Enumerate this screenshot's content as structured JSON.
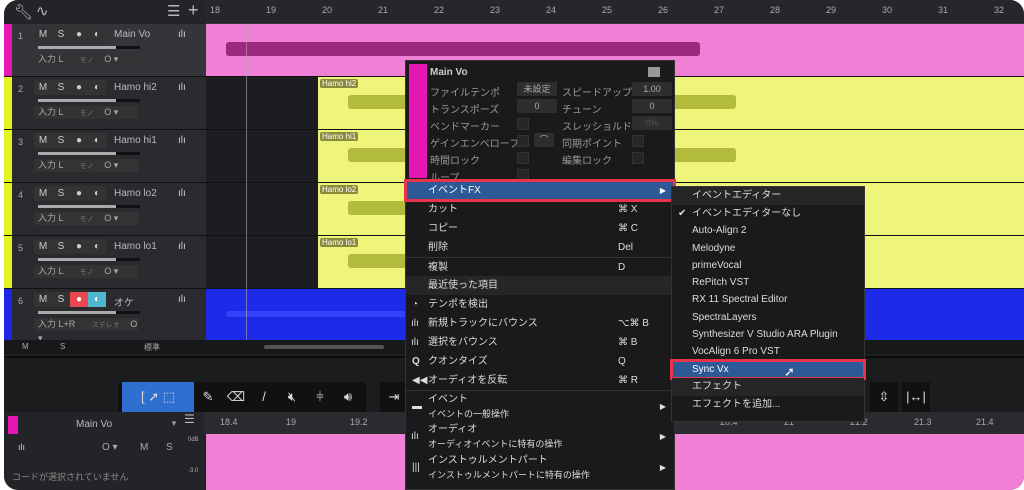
{
  "toolbar_top": {
    "wrench": "wrench-icon",
    "automation": "automation-icon"
  },
  "ruler": [
    "18",
    "19",
    "20",
    "21",
    "22",
    "23",
    "24",
    "25",
    "26",
    "27",
    "28",
    "29",
    "30",
    "31",
    "32"
  ],
  "tracks": [
    {
      "num": "1",
      "name": "Main Vo",
      "input": "入力 L",
      "mode": "モノ",
      "color": "#e617b4",
      "lane": "#f07fd6"
    },
    {
      "num": "2",
      "name": "Hamo hi2",
      "input": "入力 L",
      "mode": "モノ",
      "color": "#e3f320",
      "lane": "#eef57a",
      "clip": "Hamo hi2"
    },
    {
      "num": "3",
      "name": "Hamo hi1",
      "input": "入力 L",
      "mode": "モノ",
      "color": "#e3f320",
      "lane": "#eef57a",
      "clip": "Hamo hi1"
    },
    {
      "num": "4",
      "name": "Hamo lo2",
      "input": "入力 L",
      "mode": "モノ",
      "color": "#e3f320",
      "lane": "#eef57a",
      "clip": "Hamo lo2"
    },
    {
      "num": "5",
      "name": "Hamo lo1",
      "input": "入力 L",
      "mode": "モノ",
      "color": "#e3f320",
      "lane": "#eef57a",
      "clip": "Hamo lo1"
    },
    {
      "num": "6",
      "name": "オケ",
      "input": "入力 L+R",
      "mode": "ステレオ",
      "color": "#1e26e6",
      "lane": "#1d2ae8"
    }
  ],
  "track_btn": {
    "m": "M",
    "s": "S"
  },
  "bottom_bar": {
    "m": "M",
    "s": "S",
    "view": "標準"
  },
  "inspector": {
    "title": "Main Vo",
    "file_tempo_label": "ファイルテンポ",
    "file_tempo": "未設定",
    "speedup_label": "スピードアップ",
    "speedup": "1.00",
    "transpose_label": "トランスポーズ",
    "transpose": "0",
    "tune_label": "チューン",
    "tune": "0",
    "bend_label": "ベンドマーカー",
    "threshold_label": "スレッショルド",
    "threshold": "0%",
    "gain_label": "ゲインエンベロープ",
    "sync_label": "同期ポイント",
    "timelock_label": "時間ロック",
    "editlock_label": "編集ロック",
    "loop_label": "ループ"
  },
  "menu": {
    "event_fx": "イベントFX",
    "cut": "カット",
    "cut_sc": "⌘ X",
    "copy": "コピー",
    "copy_sc": "⌘ C",
    "delete": "削除",
    "delete_sc": "Del",
    "duplicate": "複製",
    "duplicate_sc": "D",
    "recent": "最近使った項目",
    "detect_tempo": "テンポを検出",
    "bounce_new": "新規トラックにバウンス",
    "bounce_new_sc": "⌥⌘ B",
    "bounce_sel": "選択をバウンス",
    "bounce_sel_sc": "⌘ B",
    "quantize": "クオンタイズ",
    "quantize_sc": "Q",
    "reverse": "オーディオを反転",
    "reverse_sc": "⌘ R",
    "event": "イベント",
    "event_sub": "イベントの一般操作",
    "audio": "オーディオ",
    "audio_sub": "オーディオイベントに特有の操作",
    "inst": "インストゥルメントパート",
    "inst_sub": "インストゥルメントパートに特有の操作"
  },
  "submenu": {
    "header": "イベントエディター",
    "items": [
      "イベントエディターなし",
      "Auto-Align 2",
      "Melodyne",
      "primeVocal",
      "RePitch VST",
      "RX 11 Spectral Editor",
      "SpectraLayers",
      "Synthesizer V Studio ARA Plugin",
      "VocAlign 6 Pro VST",
      "Sync Vx"
    ],
    "effects_header": "エフェクト",
    "add_effect": "エフェクトを追加..."
  },
  "editor": {
    "track": "Main Vo",
    "m": "M",
    "s": "S",
    "no_chord": "コードが選択されていません",
    "ruler": [
      "18.4",
      "19",
      "19.2",
      "20.4",
      "21",
      "21.2",
      "21.3",
      "21.4"
    ],
    "db0": "0dB",
    "db3": "-3.0"
  }
}
